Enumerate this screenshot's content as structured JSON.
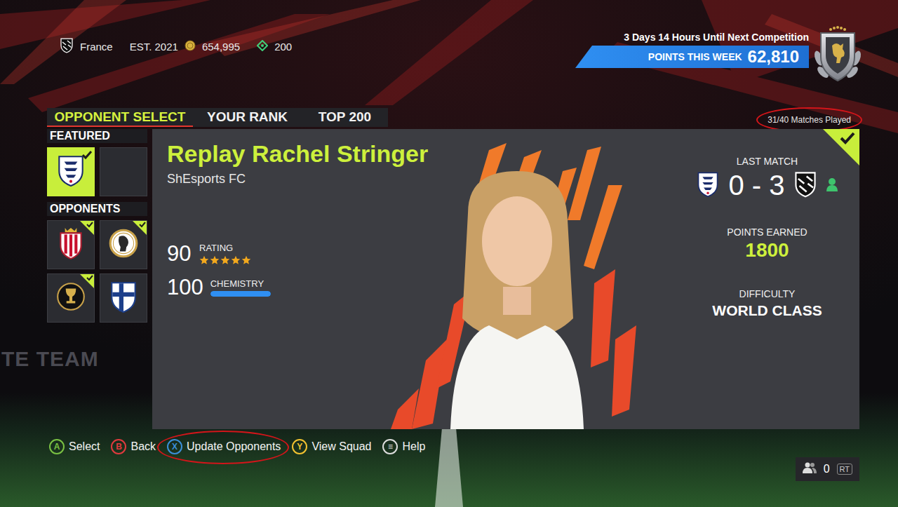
{
  "header": {
    "country": "France",
    "established": "EST. 2021",
    "coins": "654,995",
    "points": "200"
  },
  "competition": {
    "countdown": "3 Days 14 Hours Until Next Competition",
    "points_label": "POINTS THIS WEEK",
    "points_value": "62,810"
  },
  "tabs": [
    {
      "label": "OPPONENT SELECT",
      "selected": true
    },
    {
      "label": "YOUR RANK",
      "selected": false
    },
    {
      "label": "TOP 200",
      "selected": false
    }
  ],
  "matches": {
    "text": "31/40 Matches Played",
    "circled": true
  },
  "featured": {
    "label": "FEATURED",
    "tiles": [
      {
        "kind": "england",
        "selected": true,
        "checked": true
      },
      {
        "kind": "empty",
        "selected": false,
        "checked": false
      }
    ]
  },
  "opponents": {
    "label": "OPPONENTS",
    "tiles": [
      {
        "kind": "gijon",
        "selected": false,
        "checked": true
      },
      {
        "kind": "ajax",
        "selected": false,
        "checked": true
      },
      {
        "kind": "libertadores",
        "selected": false,
        "checked": true
      },
      {
        "kind": "finland",
        "selected": false,
        "checked": false
      }
    ]
  },
  "card": {
    "title": "Replay Rachel Stringer",
    "club": "ShEsports FC",
    "rating": "90",
    "rating_label": "RATING",
    "stars": 5,
    "chemistry": "100",
    "chemistry_label": "CHEMISTRY",
    "chemistry_level": 1,
    "completed": true,
    "last_match_label": "LAST MATCH",
    "home_kind": "england",
    "score": "0 - 3",
    "away_kind": "zebras",
    "points_label": "POINTS EARNED",
    "points": "1800",
    "difficulty_label": "DIFFICULTY",
    "difficulty": "WORLD CLASS"
  },
  "controls": [
    {
      "key": "A",
      "label": "Select",
      "color": "#7ac143",
      "circled": false
    },
    {
      "key": "B",
      "label": "Back",
      "color": "#e03a3e",
      "circled": false
    },
    {
      "key": "X",
      "label": "Update Opponents",
      "color": "#3b8fd9",
      "circled": true
    },
    {
      "key": "Y",
      "label": "View Squad",
      "color": "#f2c230",
      "circled": false
    },
    {
      "key": "≡",
      "label": "Help",
      "color": "#dddddd",
      "circled": false
    }
  ],
  "friends": {
    "count": "0",
    "key": "RT"
  },
  "watermark": "TE TEAM"
}
